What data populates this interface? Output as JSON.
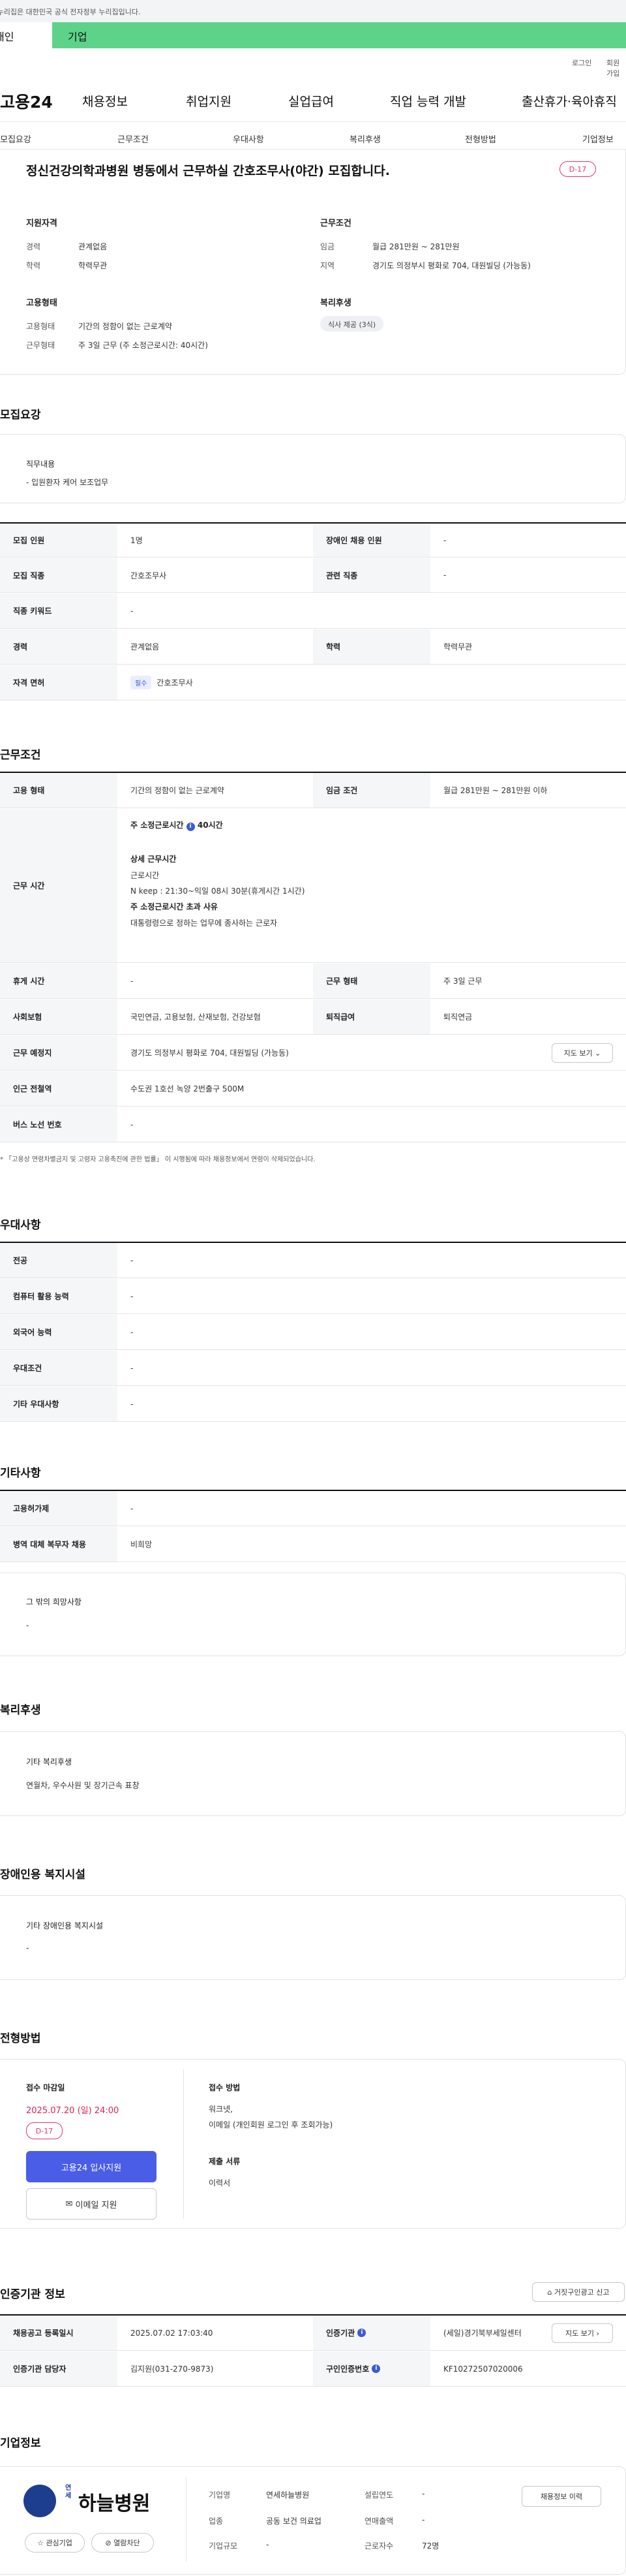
{
  "gov_banner": "이 누리집은 대한민국 공식 전자정부 누리집입니다.",
  "top_tabs": [
    "개인",
    "기업"
  ],
  "util": [
    "로그인",
    "회원가입"
  ],
  "logo": "고용24",
  "gnb": [
    "채용정보",
    "취업지원",
    "실업급여",
    "직업 능력 개발",
    "출산휴가·육아휴직"
  ],
  "anchors": [
    "모집요강",
    "근무조건",
    "우대사항",
    "복리후생",
    "전형방법",
    "기업정보"
  ],
  "header": {
    "title": "정신건강의학과병원 병동에서 근무하실 간호조무사(야간) 모집합니다.",
    "dday": "D-17"
  },
  "summary": {
    "qual_title": "지원자격",
    "career_l": "경력",
    "career_v": "관계없음",
    "edu_l": "학력",
    "edu_v": "학력무관",
    "cond_title": "근무조건",
    "wage_l": "임금",
    "wage_v": "월급 281만원 ~ 281만원",
    "region_l": "지역",
    "region_v": "경기도 의정부시 평화로 704, 대원빌딩 (가능동)",
    "emp_title": "고용형태",
    "type_l": "고용형태",
    "type_v": "기간의 정함이 없는 근로계약",
    "form_l": "근무형태",
    "form_v": "주 3일 근무 (주 소정근로시간: 40시간)",
    "ben_title": "복리후생",
    "ben_chip": "식사 제공 (3식)"
  },
  "recruit": {
    "title": "모집요강",
    "job_title": "직무내용",
    "job_desc": "- 입원환자 케어 보조업무",
    "rows": [
      {
        "k": "모집 인원",
        "v": "1명",
        "k2": "장애인 채용 인원",
        "v2": "-"
      },
      {
        "k": "모집 직종",
        "v": "간호조무사",
        "k2": "관련 직종",
        "v2": "-"
      },
      {
        "k": "직종 키워드",
        "v": "-"
      },
      {
        "k": "경력",
        "v": "관계없음",
        "k2": "학력",
        "v2": "학력무관"
      },
      {
        "k": "자격 면허",
        "chip": "필수",
        "v": "간호조무사"
      }
    ]
  },
  "work": {
    "title": "근무조건",
    "emp_k": "고용 형태",
    "emp_v": "기간의 정함이 없는 근로계약",
    "wage_k": "임금 조건",
    "wage_v": "월급 281만원 ~ 281만원 이하",
    "time_k": "근무 시간",
    "time_lines": [
      "주 소정근로시간",
      "40시간",
      "상세 근무시간",
      "근로시간",
      "N keep : 21:30~익일 08시 30분(휴게시간 1시간)",
      "주 소정근로시간 초과 사유",
      "대통령령으로 정하는 업무에 종사하는 근로자"
    ],
    "rest_k": "휴게 시간",
    "rest_v": "-",
    "form_k": "근무 형태",
    "form_v": "주 3일 근무",
    "ins_k": "사회보험",
    "ins_v": "국민연금, 고용보험, 산재보험, 건강보험",
    "sev_k": "퇴직급여",
    "sev_v": "퇴직연금",
    "place_k": "근무 예정지",
    "place_v": "경기도 의정부시 평화로 704, 대원빌딩 (가능동)",
    "map_btn": "지도 보기",
    "sub_k": "인근 전철역",
    "sub_v": "수도권 1호선 녹양 2번출구 500M",
    "bus_k": "버스 노선 번호",
    "bus_v": "-",
    "note": "* 「고용상 연령차별금지 및 고령자 고용촉진에 관한 법률」 이 시행됨에 따라 채용정보에서 연령이 삭제되었습니다."
  },
  "pref": {
    "title": "우대사항",
    "rows": [
      {
        "k": "전공",
        "v": "-"
      },
      {
        "k": "컴퓨터 활용 능력",
        "v": "-"
      },
      {
        "k": "외국어 능력",
        "v": "-"
      },
      {
        "k": "우대조건",
        "v": "-"
      },
      {
        "k": "기타 우대사항",
        "v": "-"
      }
    ]
  },
  "etc": {
    "title": "기타사항",
    "rows": [
      {
        "k": "고용허가제",
        "v": "-"
      },
      {
        "k": "병역 대체 복무자 채용",
        "v": "비희망"
      }
    ],
    "box_title": "그 밖의 희망사항",
    "box_v": "-"
  },
  "welfare": {
    "title": "복리후생",
    "box_title": "기타 복리후생",
    "box_v": "연월차, 우수사원 및 장기근속 표창"
  },
  "disab": {
    "title": "장애인용 복지시설",
    "box_title": "기타 장애인용 복지시설",
    "box_v": "-"
  },
  "apply": {
    "title": "전형방법",
    "deadline_l": "접수 마감일",
    "deadline_v": "2025.07.20 (일) 24:00",
    "dday": "D-17",
    "btn_apply": "고용24 입사지원",
    "btn_email": "이메일 지원",
    "method_l": "접수 방법",
    "method_v1": "워크넷,",
    "method_v2": "이메일 (개인회원 로그인 후 조회가능)",
    "docs_l": "제출 서류",
    "docs_v": "이력서"
  },
  "cert": {
    "title": "인증기관 정보",
    "report_btn": "거짓구인광고 신고",
    "reg_k": "채용공고 등록일시",
    "reg_v": "2025.07.02 17:03:40",
    "org_k": "인증기관",
    "org_v": "(세일)경기북부세일센터",
    "map_btn": "지도 보기",
    "mgr_k": "인증기관 담당자",
    "mgr_v": "김지원(031-270-9873)",
    "no_k": "구인인증번호",
    "no_v": "KF10272507020006"
  },
  "company": {
    "title": "기업정보",
    "logo_text": "하늘병원",
    "logo_sub": "연세",
    "fav_btn": "관심기업",
    "block_btn": "열람차단",
    "name_k": "기업명",
    "name_v": "연세하늘병원",
    "year_k": "설립연도",
    "year_v": "-",
    "ind_k": "업종",
    "ind_v": "공동 보건 의료업",
    "sales_k": "연매출액",
    "sales_v": "-",
    "size_k": "기업규모",
    "size_v": "-",
    "emp_k": "근로자수",
    "emp_v": "72명",
    "history_btn": "채용정보 이력"
  }
}
